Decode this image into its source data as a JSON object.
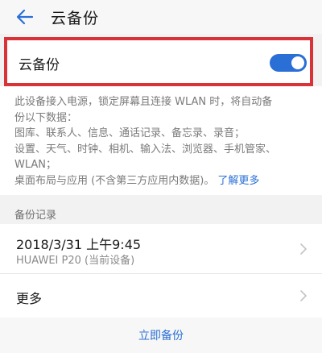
{
  "header": {
    "title": "云备份",
    "back_icon": "arrow-left-icon"
  },
  "backup_toggle": {
    "label": "云备份",
    "enabled": true
  },
  "description": {
    "line1": "此设备接入电源，锁定屏幕且连接 WLAN 时，将自动备",
    "line2": "份以下数据：",
    "line3": "图库、联系人、信息、通话记录、备忘录、录音；",
    "line4": "设置、天气、时钟、相机、输入法、浏览器、手机管家、",
    "line5": "WLAN；",
    "line6": "桌面布局与应用 (不含第三方应用内数据)。",
    "learn_more": "了解更多"
  },
  "records_section": {
    "title": "备份记录",
    "latest": {
      "datetime": "2018/3/31 上午9:45",
      "device": "HUAWEI P20 (当前设备)"
    },
    "more_label": "更多"
  },
  "footer": {
    "backup_now_label": "立即备份"
  },
  "colors": {
    "accent": "#2a6fd6",
    "highlight_border": "#d9333a"
  }
}
